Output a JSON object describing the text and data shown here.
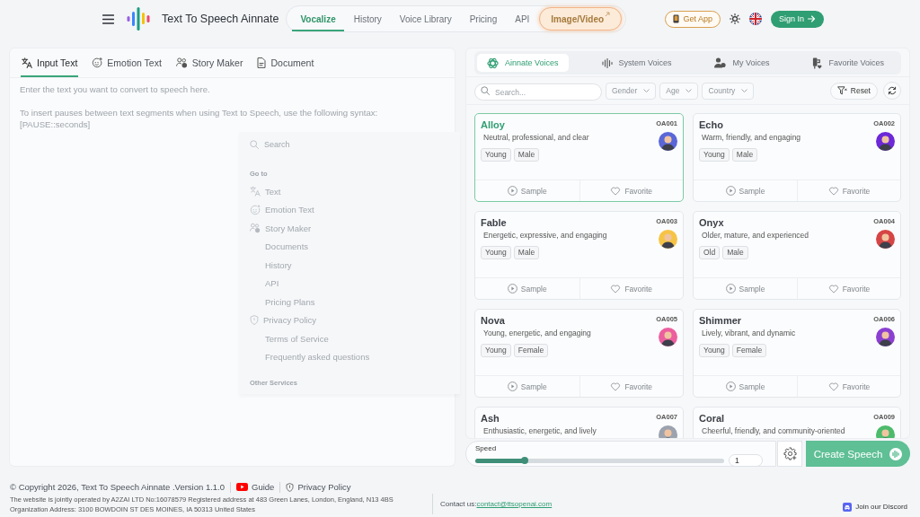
{
  "header": {
    "brand": "Text To Speech Ainnate",
    "nav": [
      {
        "label": "Vocalize",
        "kind": "tab",
        "selected": true
      },
      {
        "label": "History",
        "kind": "tab",
        "selected": false
      },
      {
        "label": "Voice Library",
        "kind": "tab",
        "selected": false
      },
      {
        "label": "Pricing",
        "kind": "tab",
        "selected": false
      },
      {
        "label": "API",
        "kind": "tab",
        "selected": false
      },
      {
        "label": "Image/Video",
        "kind": "promo",
        "selected": false
      }
    ],
    "get_app": "Get App",
    "sign_in": "Sign In"
  },
  "input_panel": {
    "tabs": [
      {
        "label": "Input Text",
        "kind": "input",
        "selected": true
      },
      {
        "label": "Emotion Text",
        "kind": "emotion",
        "selected": false
      },
      {
        "label": "Story Maker",
        "kind": "story",
        "selected": false
      },
      {
        "label": "Document",
        "kind": "document",
        "selected": false
      }
    ],
    "placeholder": "Enter the text you want to convert to speech here.\n\nTo insert pauses between text segments when using Text to Speech, use the following syntax: [PAUSE::seconds]"
  },
  "command_palette": {
    "search_placeholder": "Search",
    "heading": "Go to",
    "items": [
      {
        "label": "Text",
        "kind": "input"
      },
      {
        "label": "Emotion Text",
        "kind": "emotion"
      },
      {
        "label": "Story Maker",
        "kind": "story"
      },
      {
        "label": "Documents",
        "kind": "page"
      },
      {
        "label": "History",
        "kind": "page"
      },
      {
        "label": "API",
        "kind": "page"
      },
      {
        "label": "Pricing Plans",
        "kind": "page"
      },
      {
        "label": "Privacy Policy",
        "kind": "policy"
      },
      {
        "label": "Terms of Service",
        "kind": "page"
      },
      {
        "label": "Frequently asked questions",
        "kind": "page"
      }
    ],
    "second_heading": "Other Services"
  },
  "voices": {
    "tabs": [
      {
        "label": "Ainnate Voices",
        "kind": "ainnate",
        "selected": true
      },
      {
        "label": "System Voices",
        "kind": "system",
        "selected": false
      },
      {
        "label": "My Voices",
        "kind": "mine",
        "selected": false
      },
      {
        "label": "Favorite Voices",
        "kind": "favorite",
        "selected": false
      }
    ],
    "search_placeholder": "Search...",
    "filters": [
      "Gender",
      "Age",
      "Country"
    ],
    "reset": "Reset",
    "list": [
      {
        "name": "Alloy",
        "code": "OA001",
        "description": "Neutral, professional, and clear",
        "tags": [
          "Young",
          "Male"
        ],
        "color": "#5a67d8",
        "selected": true,
        "actions": [
          {
            "label": "Sample",
            "kind": "sample"
          },
          {
            "label": "Favorite",
            "kind": "favorite"
          }
        ]
      },
      {
        "name": "Echo",
        "code": "OA002",
        "description": "Warm, friendly, and engaging",
        "tags": [
          "Young",
          "Male"
        ],
        "color": "#6d28d9",
        "selected": false,
        "actions": [
          {
            "label": "Sample",
            "kind": "sample"
          },
          {
            "label": "Favorite",
            "kind": "favorite"
          }
        ]
      },
      {
        "name": "Fable",
        "code": "OA003",
        "description": "Energetic, expressive, and engaging",
        "tags": [
          "Young",
          "Male"
        ],
        "color": "#f6c445",
        "selected": false,
        "actions": [
          {
            "label": "Sample",
            "kind": "sample"
          },
          {
            "label": "Favorite",
            "kind": "favorite"
          }
        ]
      },
      {
        "name": "Onyx",
        "code": "OA004",
        "description": "Older, mature, and experienced",
        "tags": [
          "Old",
          "Male"
        ],
        "color": "#d64545",
        "selected": false,
        "actions": [
          {
            "label": "Sample",
            "kind": "sample"
          },
          {
            "label": "Favorite",
            "kind": "favorite"
          }
        ]
      },
      {
        "name": "Nova",
        "code": "OA005",
        "description": "Young, energetic, and engaging",
        "tags": [
          "Young",
          "Female"
        ],
        "color": "#ec5f9f",
        "selected": false,
        "actions": [
          {
            "label": "Sample",
            "kind": "sample"
          },
          {
            "label": "Favorite",
            "kind": "favorite"
          }
        ]
      },
      {
        "name": "Shimmer",
        "code": "OA006",
        "description": "Lively, vibrant, and dynamic",
        "tags": [
          "Young",
          "Female"
        ],
        "color": "#8b3fd1",
        "selected": false,
        "actions": [
          {
            "label": "Sample",
            "kind": "sample"
          },
          {
            "label": "Favorite",
            "kind": "favorite"
          }
        ]
      },
      {
        "name": "Ash",
        "code": "OA007",
        "description": "Enthusiastic, energetic, and lively",
        "color": "#9ca3af",
        "selected": false
      },
      {
        "name": "Coral",
        "code": "OA009",
        "description": "Cheerful, friendly, and community-oriented",
        "color": "#4cbb6c",
        "selected": false
      }
    ]
  },
  "speed": {
    "label": "Speed",
    "level": 0.2,
    "value": "1"
  },
  "create_button": "Create Speech",
  "footer": {
    "copyright": "© Copyright 2026, Text To Speech Ainnate .Version 1.1.0",
    "guide": "Guide",
    "privacy": "Privacy Policy",
    "operator": "The website is jointly operated by A2ZAI LTD No:16078579 Registered address at 483 Green Lanes, London, England, N13 4BS",
    "address": "Organization Address: 3100 BOWDOIN ST DES MOINES, IA 50313 United States",
    "contact_label": "Contact us:",
    "contact_email": "contact@ttsopenai.com",
    "discord": "Join our Discord"
  }
}
